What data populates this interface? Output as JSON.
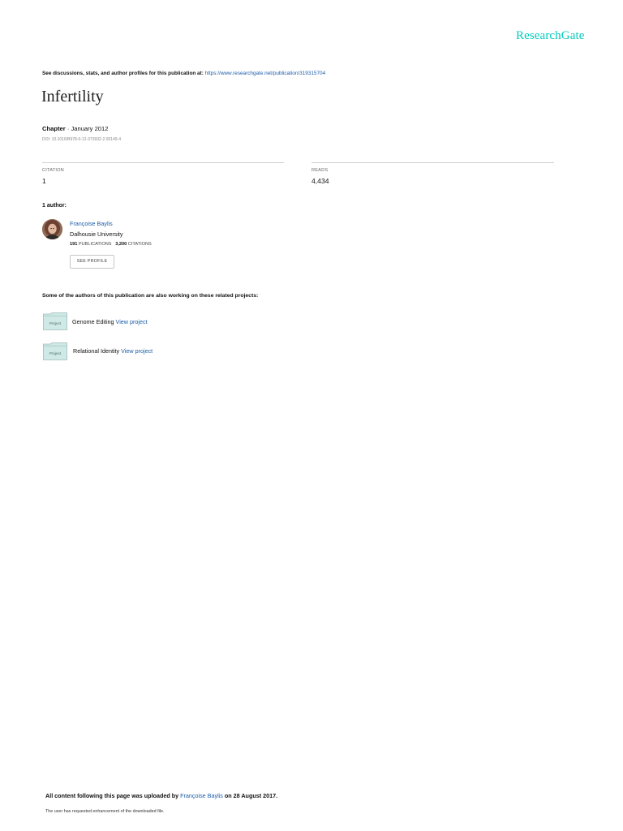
{
  "brand": {
    "logo_text": "ResearchGate",
    "accent": "#00ccbb",
    "link_color": "#1a5ca8"
  },
  "header": {
    "see_text": "See discussions, stats, and author profiles for this publication at: ",
    "url": "https://www.researchgate.net/publication/319315704"
  },
  "publication": {
    "title": "Infertility",
    "type": "Chapter",
    "separator": " · ",
    "date": "January 2012",
    "doi": "DOI: 10.1016/B978-0-12-373932-2.00149-4"
  },
  "stats": {
    "citation_label": "CITATION",
    "citation_value": "1",
    "reads_label": "READS",
    "reads_value": "4,434"
  },
  "authors": {
    "heading": "1 author:",
    "items": [
      {
        "name": "Françoise Baylis",
        "institution": "Dalhousie University",
        "publications_count": "191",
        "publications_label": "PUBLICATIONS",
        "citations_count": "3,200",
        "citations_label": "CITATIONS",
        "button_label": "SEE PROFILE"
      }
    ]
  },
  "related": {
    "heading": "Some of the authors of this publication are also working on these related projects:",
    "projects": [
      {
        "icon_label": "Project",
        "name": "Genome Editing ",
        "link": "View project"
      },
      {
        "icon_label": "Project",
        "name": "Relational Identity ",
        "link": "View project"
      }
    ]
  },
  "footer": {
    "uploaded_prefix": "All content following this page was uploaded by ",
    "uploader": "Françoise Baylis",
    "uploaded_suffix": " on 28 August 2017.",
    "enhancement": "The user has requested enhancement of the downloaded file."
  }
}
